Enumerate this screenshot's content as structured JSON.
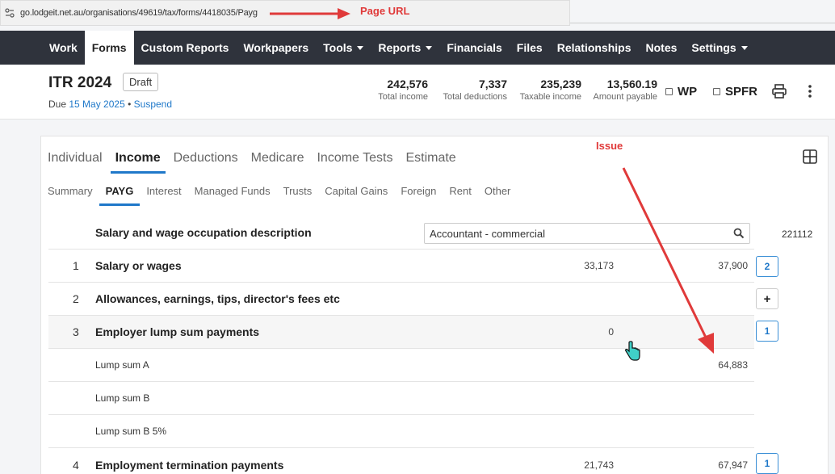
{
  "browser": {
    "url": "go.lodgeit.net.au/organisations/49619/tax/forms/4418035/Payg"
  },
  "annotations": {
    "page_url": "Page URL",
    "issue": "Issue"
  },
  "nav": {
    "items": [
      {
        "label": "Work"
      },
      {
        "label": "Forms",
        "active": true
      },
      {
        "label": "Custom Reports"
      },
      {
        "label": "Workpapers"
      },
      {
        "label": "Tools",
        "dropdown": true
      },
      {
        "label": "Reports",
        "dropdown": true
      },
      {
        "label": "Financials"
      },
      {
        "label": "Files"
      },
      {
        "label": "Relationships"
      },
      {
        "label": "Notes"
      },
      {
        "label": "Settings",
        "dropdown": true
      }
    ]
  },
  "header": {
    "title": "ITR 2024",
    "status": "Draft",
    "due_prefix": "Due",
    "due_date": "15 May 2025",
    "separator": "•",
    "suspend": "Suspend",
    "stats": [
      {
        "value": "242,576",
        "label": "Total income"
      },
      {
        "value": "7,337",
        "label": "Total deductions"
      },
      {
        "value": "235,239",
        "label": "Taxable income"
      },
      {
        "value": "13,560.19",
        "label": "Amount payable"
      }
    ],
    "wp_label": "WP",
    "spfr_label": "SPFR"
  },
  "tabs": [
    "Individual",
    "Income",
    "Deductions",
    "Medicare",
    "Income Tests",
    "Estimate"
  ],
  "active_tab": "Income",
  "subtabs": [
    "Summary",
    "PAYG",
    "Interest",
    "Managed Funds",
    "Trusts",
    "Capital Gains",
    "Foreign",
    "Rent",
    "Other"
  ],
  "active_subtab": "PAYG",
  "form": {
    "occupation": {
      "label": "Salary and wage occupation description",
      "value": "Accountant - commercial",
      "code": "221112"
    },
    "rows": [
      {
        "num": "1",
        "label": "Salary or wages",
        "v1": "33,173",
        "v2": "37,900",
        "btn": "2"
      },
      {
        "num": "2",
        "label": "Allowances, earnings, tips, director's fees etc",
        "v1": "",
        "v2": "",
        "btn": "+"
      },
      {
        "num": "3",
        "label": "Employer lump sum payments",
        "v1": "0",
        "v2": "",
        "btn": "1"
      },
      {
        "num": "",
        "label": "Lump sum A",
        "v1": "",
        "v2": "64,883",
        "btn": ""
      },
      {
        "num": "",
        "label": "Lump sum B",
        "v1": "",
        "v2": "",
        "btn": ""
      },
      {
        "num": "",
        "label": "Lump sum B 5%",
        "v1": "",
        "v2": "",
        "btn": ""
      },
      {
        "num": "4",
        "label": "Employment termination payments",
        "v1": "21,743",
        "v2": "67,947",
        "btn": "1"
      }
    ]
  },
  "colors": {
    "nav_bg": "#2f333c",
    "accent": "#1f78c9",
    "annotation": "#e03a3a"
  }
}
